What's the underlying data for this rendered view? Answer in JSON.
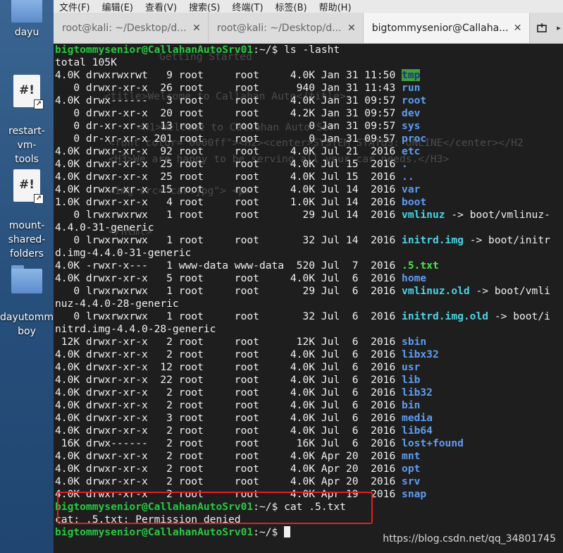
{
  "desktop": {
    "icons": [
      {
        "label": "dayu",
        "type": "folder"
      },
      {
        "label": "restart-vm-\ntools",
        "type": "script"
      },
      {
        "label": "mount-\nshared-\nfolders",
        "type": "script"
      },
      {
        "label": "dayutomm\nboy",
        "type": "folder"
      }
    ]
  },
  "menubar": {
    "items": [
      "文件(F)",
      "编辑(E)",
      "查看(V)",
      "搜索(S)",
      "终端(T)",
      "标签(B)",
      "帮助(H)"
    ]
  },
  "tabs": [
    {
      "label": "root@kali: ~/Desktop/d...",
      "close": "✕",
      "active": false
    },
    {
      "label": "root@kali: ~/Desktop/d...",
      "close": "✕",
      "active": false
    },
    {
      "label": "bigtommysenior@Callaha...",
      "close": "✕",
      "active": true
    }
  ],
  "terminal": {
    "prompt": "bigtommysenior@CallahanAutoSrv01",
    "command1": ":~/$ ls -lasht",
    "total": "total 105K",
    "listing": [
      {
        "meta": "4.0K drwxrwxrwt   9 root     root     4.0K Jan 31 11:50 ",
        "name": "tmp",
        "kind": "tmp"
      },
      {
        "meta": "   0 drwxr-xr-x  26 root     root      940 Jan 31 11:43 ",
        "name": "run",
        "kind": "dir"
      },
      {
        "meta": "4.0K drwx------   3 root     root     4.0K Jan 31 09:57 ",
        "name": "root",
        "kind": "dir"
      },
      {
        "meta": "   0 drwxr-xr-x  20 root     root     4.2K Jan 31 09:57 ",
        "name": "dev",
        "kind": "dir"
      },
      {
        "meta": "   0 dr-xr-xr-x  13 root     root        0 Jan 31 09:57 ",
        "name": "sys",
        "kind": "dir"
      },
      {
        "meta": "   0 dr-xr-xr-x 201 root     root        0 Jan 31 09:57 ",
        "name": "proc",
        "kind": "dir"
      },
      {
        "meta": "4.0K drwxr-xr-x  92 root     root     4.0K Jul 21  2016 ",
        "name": "etc",
        "kind": "dir"
      },
      {
        "meta": "4.0K drwxr-xr-x  25 root     root     4.0K Jul 15  2016 ",
        "name": ".",
        "kind": "dir"
      },
      {
        "meta": "4.0K drwxr-xr-x  25 root     root     4.0K Jul 15  2016 ",
        "name": "..",
        "kind": "dir"
      },
      {
        "meta": "4.0K drwxr-xr-x  15 root     root     4.0K Jul 14  2016 ",
        "name": "var",
        "kind": "dir"
      },
      {
        "meta": "1.0K drwxr-xr-x   4 root     root     1.0K Jul 14  2016 ",
        "name": "boot",
        "kind": "dir"
      },
      {
        "meta": "   0 lrwxrwxrwx   1 root     root       29 Jul 14  2016 ",
        "name": "vmlinuz",
        "kind": "link",
        "target": " -> boot/vmlinuz-"
      },
      {
        "meta": "4.4.0-31-generic",
        "name": "",
        "kind": "plain"
      },
      {
        "meta": "   0 lrwxrwxrwx   1 root     root       32 Jul 14  2016 ",
        "name": "initrd.img",
        "kind": "link",
        "target": " -> boot/initr"
      },
      {
        "meta": "d.img-4.4.0-31-generic",
        "name": "",
        "kind": "plain"
      },
      {
        "meta": "4.0K -rwxr-x---   1 www-data www-data  520 Jul  7  2016 ",
        "name": ".5.txt",
        "kind": "exec"
      },
      {
        "meta": "4.0K drwxr-xr-x   5 root     root     4.0K Jul  6  2016 ",
        "name": "home",
        "kind": "dir"
      },
      {
        "meta": "   0 lrwxrwxrwx   1 root     root       29 Jul  6  2016 ",
        "name": "vmlinuz.old",
        "kind": "link",
        "target": " -> boot/vmli"
      },
      {
        "meta": "nuz-4.4.0-28-generic",
        "name": "",
        "kind": "plain"
      },
      {
        "meta": "   0 lrwxrwxrwx   1 root     root       32 Jul  6  2016 ",
        "name": "initrd.img.old",
        "kind": "link",
        "target": " -> boot/i"
      },
      {
        "meta": "nitrd.img-4.4.0-28-generic",
        "name": "",
        "kind": "plain"
      },
      {
        "meta": " 12K drwxr-xr-x   2 root     root      12K Jul  6  2016 ",
        "name": "sbin",
        "kind": "dir"
      },
      {
        "meta": "4.0K drwxr-xr-x   2 root     root     4.0K Jul  6  2016 ",
        "name": "libx32",
        "kind": "dir"
      },
      {
        "meta": "4.0K drwxr-xr-x  12 root     root     4.0K Jul  6  2016 ",
        "name": "usr",
        "kind": "dir"
      },
      {
        "meta": "4.0K drwxr-xr-x  22 root     root     4.0K Jul  6  2016 ",
        "name": "lib",
        "kind": "dir"
      },
      {
        "meta": "4.0K drwxr-xr-x   2 root     root     4.0K Jul  6  2016 ",
        "name": "lib32",
        "kind": "dir"
      },
      {
        "meta": "4.0K drwxr-xr-x   2 root     root     4.0K Jul  6  2016 ",
        "name": "bin",
        "kind": "dir"
      },
      {
        "meta": "4.0K drwxr-xr-x   3 root     root     4.0K Jul  6  2016 ",
        "name": "media",
        "kind": "dir"
      },
      {
        "meta": "4.0K drwxr-xr-x   2 root     root     4.0K Jul  6  2016 ",
        "name": "lib64",
        "kind": "dir"
      },
      {
        "meta": " 16K drwx------   2 root     root      16K Jul  6  2016 ",
        "name": "lost+found",
        "kind": "dir"
      },
      {
        "meta": "4.0K drwxr-xr-x   2 root     root     4.0K Apr 20  2016 ",
        "name": "mnt",
        "kind": "dir"
      },
      {
        "meta": "4.0K drwxr-xr-x   2 root     root     4.0K Apr 20  2016 ",
        "name": "opt",
        "kind": "dir"
      },
      {
        "meta": "4.0K drwxr-xr-x   2 root     root     4.0K Apr 20  2016 ",
        "name": "srv",
        "kind": "dir"
      },
      {
        "meta": "4.0K drwxr-xr-x   2 root     root     4.0K Apr 19  2016 ",
        "name": "snap",
        "kind": "dir"
      }
    ],
    "command2": ":~/$ cat .5.txt",
    "error": "cat: .5.txt: Permission denied",
    "prompt_end": ":~/$ ",
    "ghost_lines": [
      "Getting Started",
      "<title>Welcome to Callahan Auto</title>",
      "<H1>Welcome to Callahan Auto Ser",
      "<font color=\"0000ff\"><H2><center>SYSTEM STATUS: ONLINE</center></H2",
      "<H3>We are happy to be serving all your car needs.</H3>",
      "<img src=\"car.jpg\"> <p>",
      "</html>"
    ]
  },
  "watermark": "https://blog.csdn.net/qq_34801745",
  "colors": {
    "highlight_box": "#e02020",
    "prompt": "#28c943",
    "directory": "#5e9df0",
    "symlink": "#4ad4e6",
    "executable": "#52e04c"
  }
}
